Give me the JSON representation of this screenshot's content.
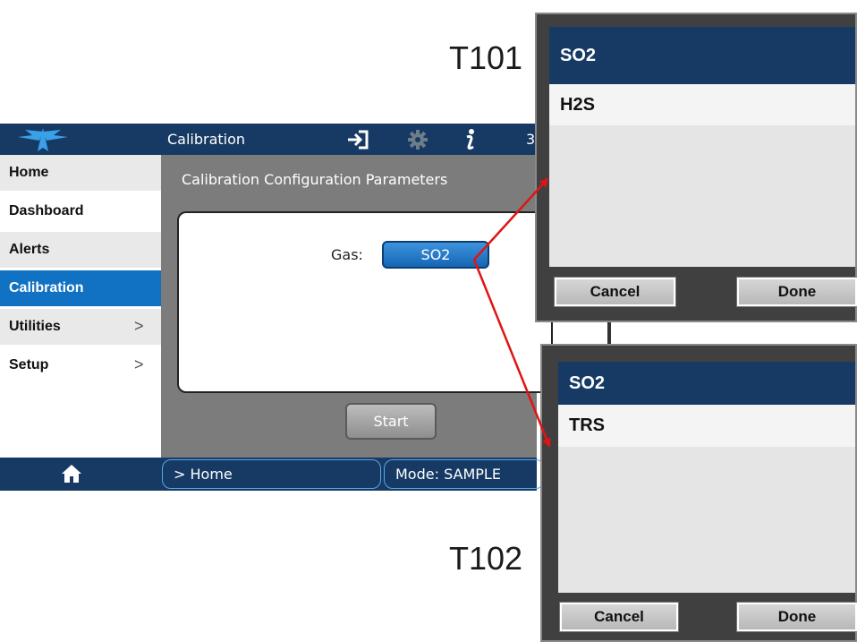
{
  "topbar": {
    "title": "Calibration",
    "extra_text": "3",
    "icons": [
      "logo-icon",
      "sign-in-icon",
      "gear-icon",
      "info-icon"
    ]
  },
  "sidebar": {
    "items": [
      {
        "label": "Home",
        "has_chevron": false
      },
      {
        "label": "Dashboard",
        "has_chevron": false
      },
      {
        "label": "Alerts",
        "has_chevron": false
      },
      {
        "label": "Calibration",
        "has_chevron": false,
        "active": true
      },
      {
        "label": "Utilities",
        "has_chevron": true
      },
      {
        "label": "Setup",
        "has_chevron": true
      }
    ],
    "chevron": ">"
  },
  "main": {
    "title": "Calibration Configuration Parameters",
    "gas_label": "Gas:",
    "gas_value": "SO2",
    "start_label": "Start"
  },
  "bottombar": {
    "breadcrumb": "> Home",
    "mode": "Mode: SAMPLE"
  },
  "labels": {
    "t101": "T101",
    "t102": "T102"
  },
  "popup_t101": {
    "header": "SO2",
    "option": "H2S",
    "cancel_label": "Cancel",
    "done_label": "Done"
  },
  "popup_t102": {
    "header": "SO2",
    "option": "TRS",
    "cancel_label": "Cancel",
    "done_label": "Done"
  },
  "colors": {
    "navy": "#163a64",
    "accent_blue": "#1171c2",
    "arrow_red": "#e01414",
    "content_gray": "#7c7c7c"
  }
}
